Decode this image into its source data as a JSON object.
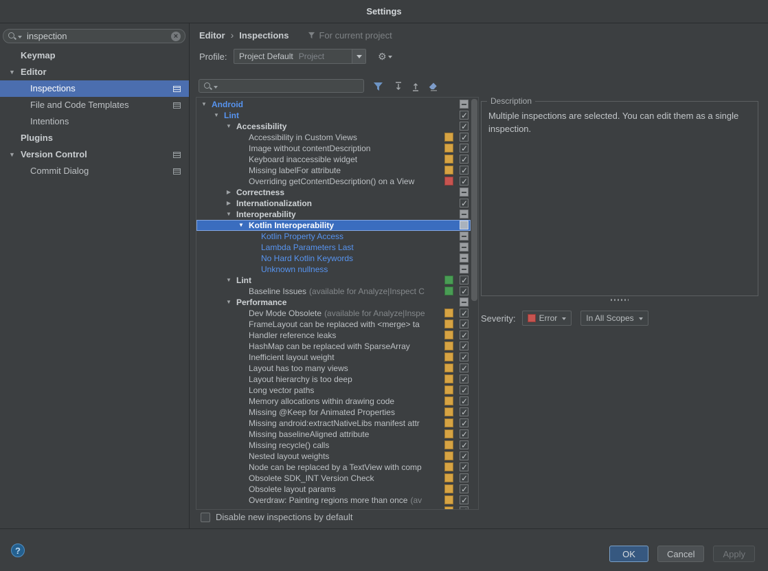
{
  "window": {
    "title": "Settings"
  },
  "sidebar": {
    "search": {
      "value": "inspection"
    },
    "items": [
      {
        "label": "Keymap",
        "bold": true,
        "child": false
      },
      {
        "label": "Editor",
        "bold": true,
        "child": false,
        "arrow": "down"
      },
      {
        "label": "Inspections",
        "child": true,
        "selected": true,
        "icon": true
      },
      {
        "label": "File and Code Templates",
        "child": true,
        "icon": true
      },
      {
        "label": "Intentions",
        "child": true
      },
      {
        "label": "Plugins",
        "bold": true,
        "child": false
      },
      {
        "label": "Version Control",
        "bold": true,
        "child": false,
        "arrow": "down",
        "icon": true
      },
      {
        "label": "Commit Dialog",
        "child": true,
        "icon": true
      }
    ]
  },
  "main": {
    "breadcrumb": {
      "items": [
        "Editor",
        "Inspections"
      ],
      "separator": "›",
      "scope": "For current project"
    },
    "profile": {
      "label": "Profile:",
      "value": "Project Default",
      "hint": "Project"
    },
    "tree": {
      "rows": [
        {
          "label": "Android",
          "indent": 0,
          "arrow": "down",
          "bold": true,
          "blue": true,
          "check": "dash"
        },
        {
          "label": "Lint",
          "indent": 1,
          "arrow": "down",
          "bold": true,
          "blue": true,
          "check": "checked"
        },
        {
          "label": "Accessibility",
          "indent": 2,
          "arrow": "down",
          "bold": true,
          "check": "checked"
        },
        {
          "label": "Accessibility in Custom Views",
          "indent": 3,
          "badge": "yellow",
          "check": "checked"
        },
        {
          "label": "Image without contentDescription",
          "indent": 3,
          "badge": "yellow",
          "check": "checked"
        },
        {
          "label": "Keyboard inaccessible widget",
          "indent": 3,
          "badge": "yellow",
          "check": "checked"
        },
        {
          "label": "Missing labelFor attribute",
          "indent": 3,
          "badge": "yellow",
          "check": "checked"
        },
        {
          "label": "Overriding getContentDescription() on a View",
          "indent": 3,
          "badge": "red",
          "check": "checked"
        },
        {
          "label": "Correctness",
          "indent": 2,
          "arrow": "right",
          "bold": true,
          "check": "dash"
        },
        {
          "label": "Internationalization",
          "indent": 2,
          "arrow": "right",
          "bold": true,
          "check": "checked"
        },
        {
          "label": "Interoperability",
          "indent": 2,
          "arrow": "down",
          "bold": true,
          "check": "dash"
        },
        {
          "label": "Kotlin Interoperability",
          "indent": 3,
          "arrow": "down",
          "bold": true,
          "selected": true,
          "check": "empty"
        },
        {
          "label": "Kotlin Property Access",
          "indent": 4,
          "blue": true,
          "check": "dash"
        },
        {
          "label": "Lambda Parameters Last",
          "indent": 4,
          "blue": true,
          "check": "dash"
        },
        {
          "label": "No Hard Kotlin Keywords",
          "indent": 4,
          "blue": true,
          "check": "dash"
        },
        {
          "label": "Unknown nullness",
          "indent": 4,
          "blue": true,
          "check": "dash"
        },
        {
          "label": "Lint",
          "indent": 2,
          "arrow": "down",
          "bold": true,
          "badge": "green",
          "check": "checked"
        },
        {
          "label": "Baseline Issues",
          "suffix": "(available for Analyze|Inspect C",
          "indent": 3,
          "badge": "green",
          "check": "checked"
        },
        {
          "label": "Performance",
          "indent": 2,
          "arrow": "down",
          "bold": true,
          "check": "dash"
        },
        {
          "label": "Dev Mode Obsolete",
          "suffix": "(available for Analyze|Inspe",
          "indent": 3,
          "badge": "yellow",
          "check": "checked"
        },
        {
          "label": "FrameLayout can be replaced with <merge> ta",
          "indent": 3,
          "badge": "yellow",
          "check": "checked"
        },
        {
          "label": "Handler reference leaks",
          "indent": 3,
          "badge": "yellow",
          "check": "checked"
        },
        {
          "label": "HashMap can be replaced with SparseArray",
          "indent": 3,
          "badge": "yellow",
          "check": "checked"
        },
        {
          "label": "Inefficient layout weight",
          "indent": 3,
          "badge": "yellow",
          "check": "checked"
        },
        {
          "label": "Layout has too many views",
          "indent": 3,
          "badge": "yellow",
          "check": "checked"
        },
        {
          "label": "Layout hierarchy is too deep",
          "indent": 3,
          "badge": "yellow",
          "check": "checked"
        },
        {
          "label": "Long vector paths",
          "indent": 3,
          "badge": "yellow",
          "check": "checked"
        },
        {
          "label": "Memory allocations within drawing code",
          "indent": 3,
          "badge": "yellow",
          "check": "checked"
        },
        {
          "label": "Missing @Keep for Animated Properties",
          "indent": 3,
          "badge": "yellow",
          "check": "checked"
        },
        {
          "label": "Missing android:extractNativeLibs manifest attr",
          "indent": 3,
          "badge": "yellow",
          "check": "checked"
        },
        {
          "label": "Missing baselineAligned attribute",
          "indent": 3,
          "badge": "yellow",
          "check": "checked"
        },
        {
          "label": "Missing recycle() calls",
          "indent": 3,
          "badge": "yellow",
          "check": "checked"
        },
        {
          "label": "Nested layout weights",
          "indent": 3,
          "badge": "yellow",
          "check": "checked"
        },
        {
          "label": "Node can be replaced by a TextView with comp",
          "indent": 3,
          "badge": "yellow",
          "check": "checked"
        },
        {
          "label": "Obsolete SDK_INT Version Check",
          "indent": 3,
          "badge": "yellow",
          "check": "checked"
        },
        {
          "label": "Obsolete layout params",
          "indent": 3,
          "badge": "yellow",
          "check": "checked"
        },
        {
          "label": "Overdraw: Painting regions more than once",
          "suffix": "(av",
          "indent": 3,
          "badge": "yellow",
          "check": "checked"
        },
        {
          "label": "",
          "indent": 3,
          "badge": "yellow",
          "check": "checked"
        }
      ]
    },
    "description": {
      "title": "Description",
      "text": "Multiple inspections are selected. You can edit them as a single inspection."
    },
    "severity": {
      "label": "Severity:",
      "value": "Error",
      "scope": "In All Scopes"
    },
    "disable_checkbox": {
      "label": "Disable new inspections by default"
    }
  },
  "footer": {
    "help_label": "?",
    "ok": "OK",
    "cancel": "Cancel",
    "apply": "Apply"
  },
  "colors": {
    "background": "#3c3f41",
    "sidebar_selection": "#4b6eaf",
    "tree_selection": "#3a6dbf",
    "modified_blue": "#5794f0",
    "warning_yellow": "#d6a343",
    "error_red": "#c75450",
    "ok_green": "#499c54",
    "primary_button": "#365880"
  }
}
